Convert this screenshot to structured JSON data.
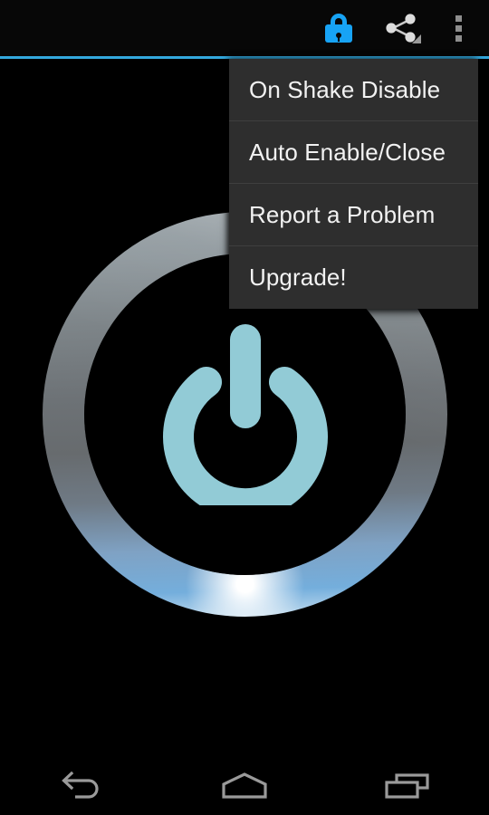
{
  "app": {
    "screen_background": "#000000",
    "accent_blue": "#17a3f5",
    "divider_blue": "#33a8dd",
    "glyph_color": "#92cbd6"
  },
  "action_bar": {
    "title": "",
    "background": "#070707",
    "items": [
      {
        "name": "lock-icon",
        "label": "Lock",
        "color": "#17a3f5"
      },
      {
        "name": "share-icon",
        "label": "Share",
        "color": "#bdbdbd",
        "has_dropdown": true
      },
      {
        "name": "overflow-icon",
        "label": "More options",
        "color": "#8d8d8d"
      }
    ]
  },
  "overflow_menu": {
    "visible": true,
    "background": "#2e2e2e",
    "divider": "#3f3f3f",
    "items": [
      {
        "label": "On Shake Disable"
      },
      {
        "label": "Auto Enable/Close"
      },
      {
        "label": "Report a Problem"
      },
      {
        "label": "Upgrade!"
      }
    ]
  },
  "main": {
    "power_button": {
      "name": "power-toggle-button",
      "state_label": "",
      "ring_top_color": "#9aa3a8",
      "ring_bottom_color": "#74aedc",
      "glyph_color": "#92cbd6"
    }
  },
  "nav_bar": {
    "background": "#000000",
    "items": [
      {
        "name": "back-icon",
        "label": "Back"
      },
      {
        "name": "home-icon",
        "label": "Home"
      },
      {
        "name": "recents-icon",
        "label": "Recent apps"
      }
    ]
  }
}
